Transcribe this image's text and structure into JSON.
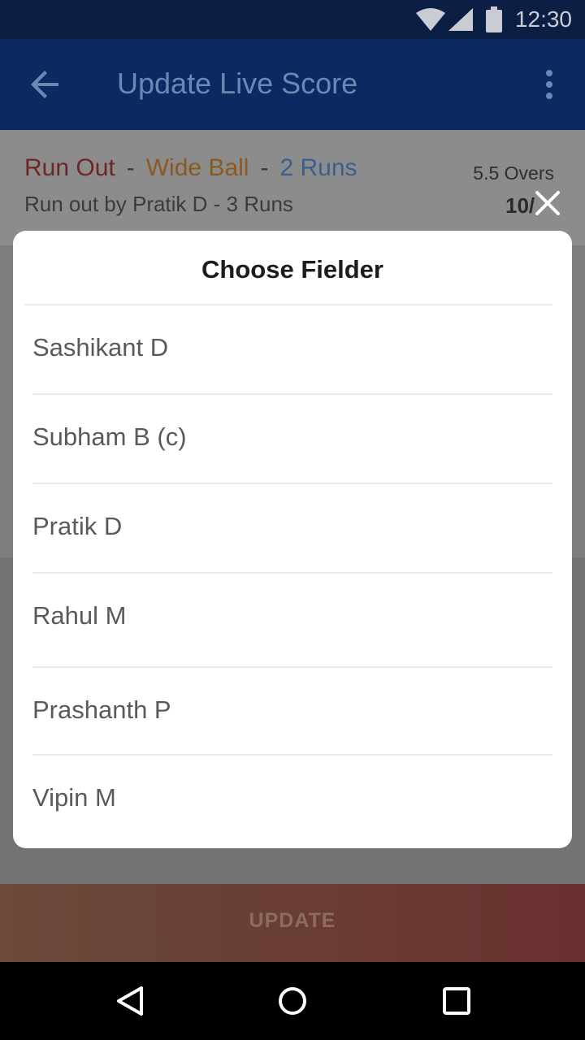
{
  "status_bar": {
    "time": "12:30",
    "icons": [
      "wifi-icon",
      "signal-icon",
      "battery-icon"
    ]
  },
  "app_bar": {
    "title": "Update Live Score",
    "back_icon": "arrow-back-icon",
    "menu_icon": "more-vert-icon",
    "color": "#0a2a61"
  },
  "summary": {
    "dismissal": "Run Out",
    "sep1": "-",
    "extra": "Wide Ball",
    "sep2": "-",
    "runs": "2 Runs",
    "detail": "Run out by Pratik D  -  3 Runs",
    "overs": "5.5 Overs",
    "score": "10/"
  },
  "dialog": {
    "title": "Choose Fielder",
    "close_icon": "close-icon",
    "fielders": [
      "Sashikant D",
      "Subham B (c)",
      "Pratik D",
      "Rahul M",
      "Prashanth P",
      "Vipin M"
    ]
  },
  "update_button": {
    "label": "UPDATE"
  },
  "nav_bar": {
    "icons": [
      "nav-back-icon",
      "nav-home-icon",
      "nav-recent-icon"
    ]
  },
  "colors": {
    "run_out": "#c62828",
    "wide_ball": "#e67e22",
    "runs": "#3d74c5",
    "app_bar": "#0a2a61"
  }
}
